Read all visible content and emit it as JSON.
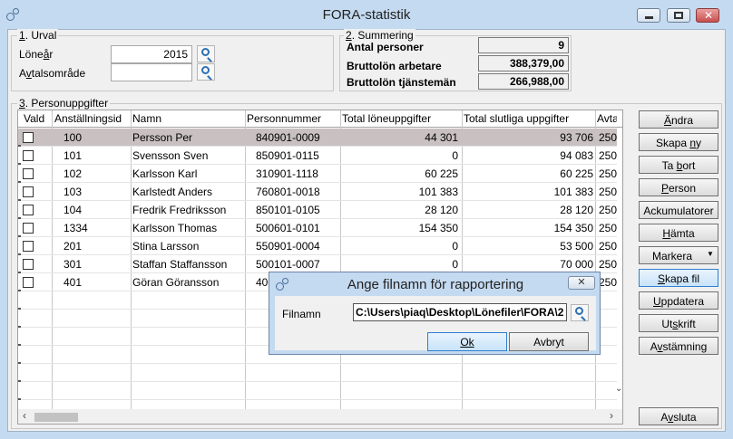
{
  "window": {
    "title": "FORA-statistik"
  },
  "urval": {
    "legend_num": "1",
    "legend_text": ". Urval",
    "lonear_label_pre": "Löne",
    "lonear_label_u": "å",
    "lonear_label_post": "r",
    "lonear_value": "2015",
    "avtal_label_pre": "A",
    "avtal_label_u": "v",
    "avtal_label_post": "talsområde",
    "avtal_value": ""
  },
  "summering": {
    "legend_num": "2",
    "legend_text": ". Summering",
    "items": [
      {
        "label": "Antal personer",
        "value": "9"
      },
      {
        "label": "Bruttolön arbetare",
        "value": "388,379,00"
      },
      {
        "label": "Bruttolön tjänstemän",
        "value": "266,988,00"
      }
    ]
  },
  "personuppgifter": {
    "legend_num": "3",
    "legend_text": ". Personuppgifter",
    "columns": [
      "Vald",
      "Anställningsid",
      "Namn",
      "Personnummer",
      "Total löneuppgifter",
      "Total slutliga uppgifter",
      "Avta"
    ],
    "rows": [
      {
        "id": "100",
        "name": "Persson Per",
        "pnr": "840901-0009",
        "total_lon": "44 301",
        "total_slut": "93 706",
        "avtal": "250",
        "selected": true
      },
      {
        "id": "101",
        "name": "Svensson Sven",
        "pnr": "850901-0115",
        "total_lon": "0",
        "total_slut": "94 083",
        "avtal": "250",
        "selected": false
      },
      {
        "id": "102",
        "name": "Karlsson Karl",
        "pnr": "310901-1118",
        "total_lon": "60 225",
        "total_slut": "60 225",
        "avtal": "250",
        "selected": false
      },
      {
        "id": "103",
        "name": "Karlstedt Anders",
        "pnr": "760801-0018",
        "total_lon": "101 383",
        "total_slut": "101 383",
        "avtal": "250",
        "selected": false
      },
      {
        "id": "104",
        "name": "Fredrik Fredriksson",
        "pnr": "850101-0105",
        "total_lon": "28 120",
        "total_slut": "28 120",
        "avtal": "250",
        "selected": false
      },
      {
        "id": "1334",
        "name": "Karlsson Thomas",
        "pnr": "500601-0101",
        "total_lon": "154 350",
        "total_slut": "154 350",
        "avtal": "250",
        "selected": false
      },
      {
        "id": "201",
        "name": "Stina Larsson",
        "pnr": "550901-0004",
        "total_lon": "0",
        "total_slut": "53 500",
        "avtal": "250",
        "selected": false
      },
      {
        "id": "301",
        "name": "Staffan Staffansson",
        "pnr": "500101-0007",
        "total_lon": "0",
        "total_slut": "70 000",
        "avtal": "250",
        "selected": false
      },
      {
        "id": "401",
        "name": "Göran Göransson",
        "pnr": "4005",
        "total_lon": "",
        "total_slut": "",
        "avtal": "250",
        "selected": false
      }
    ]
  },
  "buttons": {
    "andra": {
      "pre": "",
      "u": "Ä",
      "post": "ndra"
    },
    "skapa_ny": {
      "pre": "Skapa ",
      "u": "n",
      "post": "y"
    },
    "ta_bort": {
      "pre": "Ta ",
      "u": "b",
      "post": "ort"
    },
    "person": {
      "pre": "",
      "u": "P",
      "post": "erson"
    },
    "ackumulatorer": {
      "pre": "Ackumulatorer",
      "u": "",
      "post": ""
    },
    "hamta": {
      "pre": "",
      "u": "H",
      "post": "ämta"
    },
    "markera": {
      "pre": "Markera",
      "u": "",
      "post": ""
    },
    "skapa_fil": {
      "pre": "",
      "u": "S",
      "post": "kapa fil"
    },
    "uppdatera": {
      "pre": "",
      "u": "U",
      "post": "ppdatera"
    },
    "utskrift": {
      "pre": "Ut",
      "u": "s",
      "post": "krift"
    },
    "avstamning": {
      "pre": "A",
      "u": "v",
      "post": "stämning"
    },
    "avsluta": {
      "pre": "A",
      "u": "v",
      "post": "sluta"
    }
  },
  "dialog": {
    "title": "Ange filnamn för rapportering",
    "filnamn_label": "Filnamn",
    "filnamn_value": "C:\\Users\\piaq\\Desktop\\Lönefiler\\FORA\\2",
    "ok_label": "Ok",
    "avbryt_label": "Avbryt"
  }
}
